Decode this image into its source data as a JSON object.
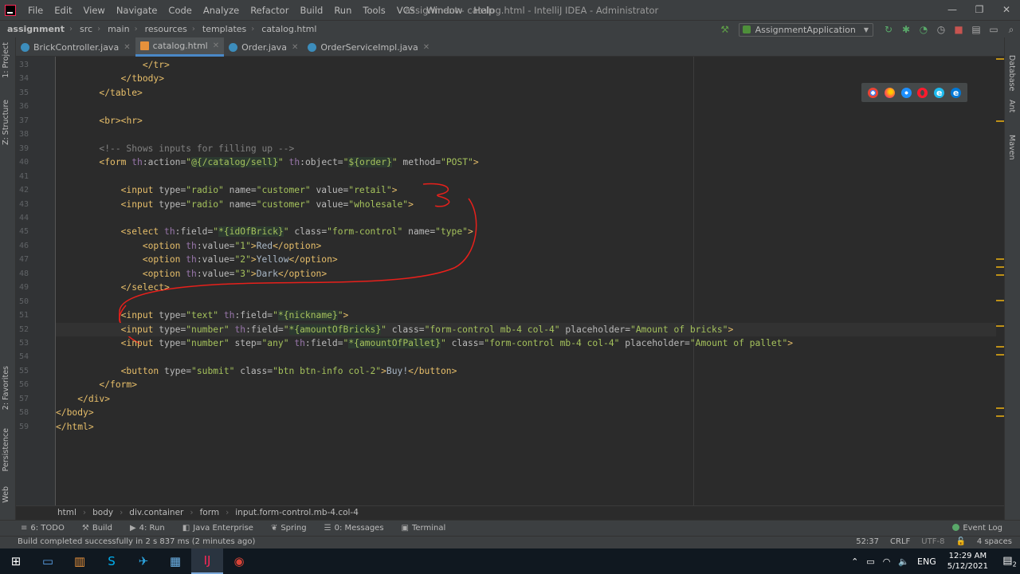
{
  "window": {
    "menu": [
      "File",
      "Edit",
      "View",
      "Navigate",
      "Code",
      "Analyze",
      "Refactor",
      "Build",
      "Run",
      "Tools",
      "VCS",
      "Window",
      "Help"
    ],
    "title": "assignment - catalog.html - IntelliJ IDEA - Administrator",
    "controls": [
      "—",
      "❐",
      "✕"
    ]
  },
  "navbar": {
    "crumbs": [
      "assignment",
      "src",
      "main",
      "resources",
      "templates",
      "catalog.html"
    ],
    "run_config": "AssignmentApplication"
  },
  "tabs": [
    {
      "label": "BrickController.java",
      "type": "java"
    },
    {
      "label": "catalog.html",
      "type": "html",
      "active": true
    },
    {
      "label": "Order.java",
      "type": "java"
    },
    {
      "label": "OrderServiceImpl.java",
      "type": "java"
    }
  ],
  "left_tools": {
    "project": "1: Project",
    "structure": "Z: Structure",
    "favorites": "2: Favorites",
    "persistence": "Persistence",
    "web": "Web"
  },
  "right_tools": {
    "database": "Database",
    "ant": "Ant",
    "maven": "Maven"
  },
  "line_numbers": [
    "33",
    "34",
    "35",
    "36",
    "37",
    "38",
    "39",
    "40",
    "41",
    "42",
    "43",
    "44",
    "45",
    "46",
    "47",
    "48",
    "49",
    "50",
    "51",
    "52",
    "53",
    "54",
    "55",
    "56",
    "57",
    "58",
    "59"
  ],
  "code_lines": [
    "                </tr>",
    "            </tbody>",
    "        </table>",
    "",
    "        <br><hr>",
    "",
    "        <!-- Shows inputs for filling up -->",
    "        <form th:action=\"@{/catalog/sell}\" th:object=\"${order}\" method=\"POST\">",
    "",
    "            <input type=\"radio\" name=\"customer\" value=\"retail\">",
    "            <input type=\"radio\" name=\"customer\" value=\"wholesale\">",
    "",
    "            <select th:field=\"*{idOfBrick}\" class=\"form-control\" name=\"type\">",
    "                <option th:value=\"1\">Red</option>",
    "                <option th:value=\"2\">Yellow</option>",
    "                <option th:value=\"3\">Dark</option>",
    "            </select>",
    "",
    "            <input type=\"text\" th:field=\"*{nickname}\">",
    "            <input type=\"number\" th:field=\"*{amountOfBricks}\" class=\"form-control mb-4 col-4\" placeholder=\"Amount of bricks\">",
    "            <input type=\"number\" step=\"any\" th:field=\"*{amountOfPallet}\" class=\"form-control mb-4 col-4\" placeholder=\"Amount of pallet\">",
    "",
    "            <button type=\"submit\" class=\"btn btn-info col-2\">Buy!</button>",
    "        </form>",
    "    </div>",
    "</body>",
    "</html>"
  ],
  "current_line": "52",
  "bottom_breadcrumb": [
    "html",
    "body",
    "div.container",
    "form",
    "input.form-control.mb-4.col-4"
  ],
  "tool_windows": [
    {
      "label": "6: TODO",
      "icon": "≡"
    },
    {
      "label": "Build",
      "icon": "⚒"
    },
    {
      "label": "4: Run",
      "icon": "▶"
    },
    {
      "label": "Java Enterprise",
      "icon": "◧"
    },
    {
      "label": "Spring",
      "icon": "❦"
    },
    {
      "label": "0: Messages",
      "icon": "☰"
    },
    {
      "label": "Terminal",
      "icon": "▣"
    }
  ],
  "event_log": "Event Log",
  "status": {
    "message": "Build completed successfully in 2 s 837 ms (2 minutes ago)",
    "position": "52:37",
    "line_ending": "CRLF",
    "encoding": "UTF-8",
    "indent": "4 spaces"
  },
  "taskbar": {
    "language": "ENG",
    "time": "12:29 AM",
    "date": "5/12/2021",
    "notifications": "2"
  },
  "colors": {
    "accent": "#4a88c7",
    "editor_bg": "#2b2b2b",
    "tag": "#e8bf6a",
    "string": "#a5c25c"
  }
}
